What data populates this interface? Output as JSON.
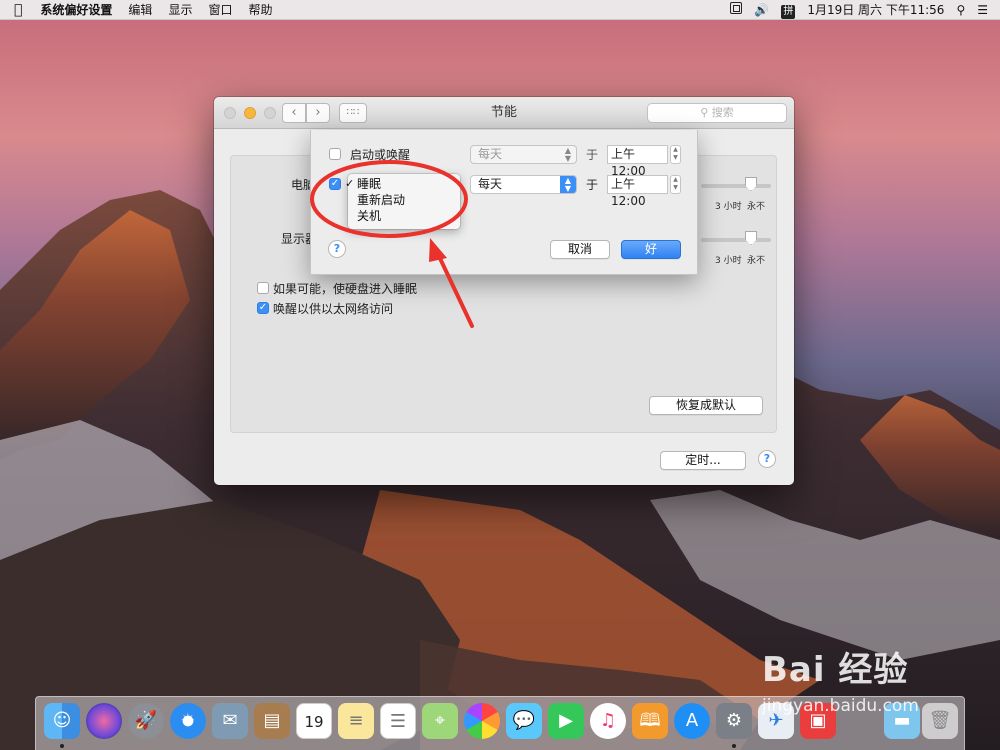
{
  "menubar": {
    "app_name": "系统偏好设置",
    "items": [
      "编辑",
      "显示",
      "窗口",
      "帮助"
    ],
    "clock": "1月19日 周六 下午11:56",
    "input_method": "拼"
  },
  "window": {
    "title": "节能",
    "search_placeholder": "搜索"
  },
  "panel": {
    "computer_sleep_label": "电脑",
    "display_sleep_label": "显示器",
    "slider_tick_3h": "3 小时",
    "slider_tick_never": "永不",
    "checkbox_disk_sleep": "如果可能，使硬盘进入睡眠",
    "checkbox_network_wake": "唤醒以供以太网络访问",
    "restore_defaults": "恢复成默认",
    "schedule": "定时..."
  },
  "sheet": {
    "row1": {
      "label": "启动或唤醒",
      "frequency": "每天",
      "at": "于",
      "time": "上午12:00",
      "checked": false
    },
    "row2": {
      "frequency": "每天",
      "at": "于",
      "time": "上午12:00",
      "checked": true
    },
    "action_menu": [
      {
        "label": "睡眠",
        "selected": true
      },
      {
        "label": "重新启动",
        "selected": false
      },
      {
        "label": "关机",
        "selected": false
      }
    ],
    "cancel": "取消",
    "ok": "好"
  },
  "calendar_day": "19",
  "watermark": {
    "brand": "Bai 经验",
    "url": "jingyan.baidu.com"
  },
  "colors": {
    "accent": "#3b8ff5",
    "annotation": "#e8322b"
  }
}
